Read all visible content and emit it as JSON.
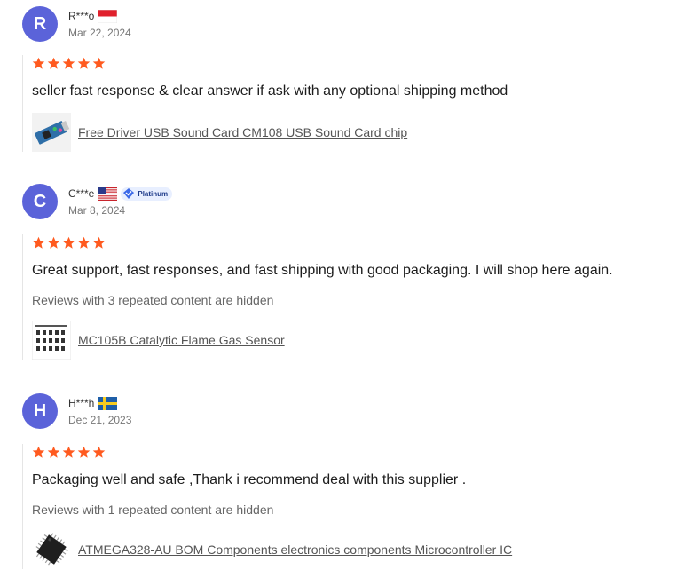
{
  "reviews": [
    {
      "initial": "R",
      "name": "R***o",
      "flag": "indonesia-flag",
      "badge": "",
      "date": "Mar 22, 2024",
      "rating": 5,
      "text": "seller fast response & clear answer if ask with any optional shipping method",
      "hidden_note": "",
      "product_icon": "usb-sound-card-thumbnail",
      "product": "Free Driver USB Sound Card CM108 USB Sound Card chip"
    },
    {
      "initial": "C",
      "name": "C***e",
      "flag": "usa-flag",
      "badge": "Platinum",
      "date": "Mar 8, 2024",
      "rating": 5,
      "text": "Great support, fast responses, and fast shipping with good packaging. I will shop here again.",
      "hidden_note": "Reviews with 3 repeated content are hidden",
      "product_icon": "gas-sensor-thumbnail",
      "product": "MC105B Catalytic Flame Gas Sensor"
    },
    {
      "initial": "H",
      "name": "H***h",
      "flag": "sweden-flag",
      "badge": "",
      "date": "Dec 21, 2023",
      "rating": 5,
      "text": "Packaging well and safe ,Thank i recommend deal with this supplier .",
      "hidden_note": "Reviews with 1 repeated content are hidden",
      "product_icon": "microcontroller-chip-thumbnail",
      "product": "ATMEGA328-AU BOM Components electronics components Microcontroller IC"
    }
  ],
  "colors": {
    "avatar": "#5b63d9",
    "star": "#ff5a1f",
    "link": "#555555"
  }
}
